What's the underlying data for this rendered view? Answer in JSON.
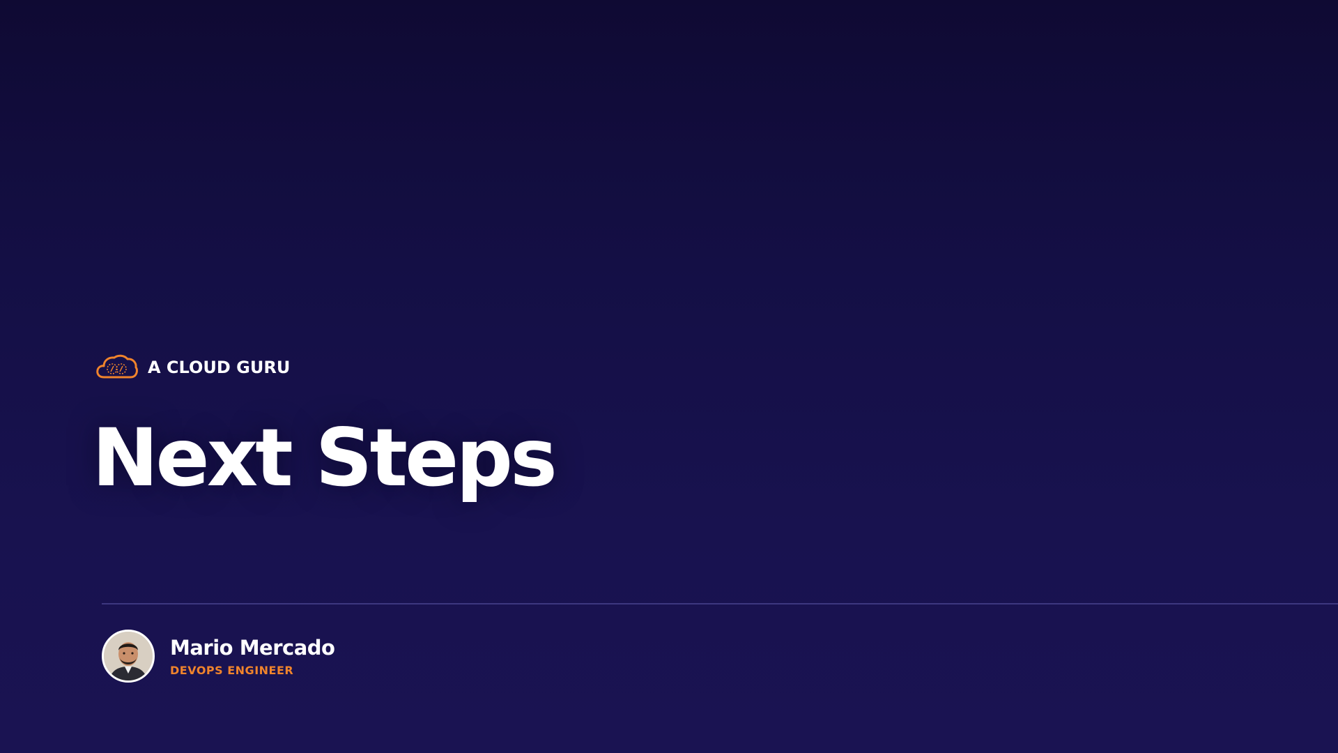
{
  "brand": {
    "name": "A CLOUD GURU",
    "logo_icon": "cloud-guru-logo-icon",
    "logo_color": "#f0842c"
  },
  "slide": {
    "title": "Next Steps"
  },
  "presenter": {
    "name": "Mario Mercado",
    "role": "DEVOPS ENGINEER",
    "avatar_icon": "presenter-avatar",
    "role_color": "#f0842c"
  },
  "colors": {
    "background_top": "#0f0a33",
    "background_bottom": "#1a1352",
    "divider": "#3d3780",
    "text": "#ffffff"
  }
}
